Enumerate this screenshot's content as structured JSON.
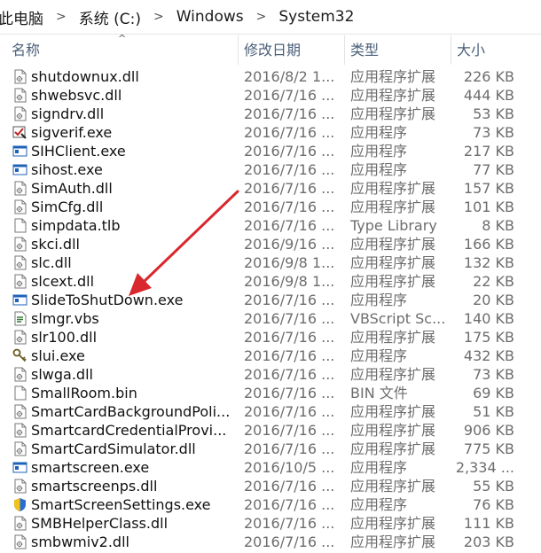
{
  "breadcrumb": {
    "items": [
      "此电脑",
      "系统 (C:)",
      "Windows",
      "System32"
    ],
    "separator": ">"
  },
  "columns": {
    "name": "名称",
    "date": "修改日期",
    "type": "类型",
    "size": "大小"
  },
  "files": [
    {
      "name": "shutdownux.dll",
      "date": "2016/8/2 1...",
      "type": "应用程序扩展",
      "size": "226 KB",
      "icon": "dll-file-icon"
    },
    {
      "name": "shwebsvc.dll",
      "date": "2016/7/16 ...",
      "type": "应用程序扩展",
      "size": "444 KB",
      "icon": "dll-file-icon"
    },
    {
      "name": "signdrv.dll",
      "date": "2016/7/16 ...",
      "type": "应用程序扩展",
      "size": "53 KB",
      "icon": "dll-file-icon"
    },
    {
      "name": "sigverif.exe",
      "date": "2016/7/16 ...",
      "type": "应用程序",
      "size": "73 KB",
      "icon": "sigverif-app-icon"
    },
    {
      "name": "SIHClient.exe",
      "date": "2016/7/16 ...",
      "type": "应用程序",
      "size": "217 KB",
      "icon": "exe-app-icon"
    },
    {
      "name": "sihost.exe",
      "date": "2016/7/16 ...",
      "type": "应用程序",
      "size": "77 KB",
      "icon": "exe-app-icon"
    },
    {
      "name": "SimAuth.dll",
      "date": "2016/7/16 ...",
      "type": "应用程序扩展",
      "size": "157 KB",
      "icon": "dll-file-icon"
    },
    {
      "name": "SimCfg.dll",
      "date": "2016/7/16 ...",
      "type": "应用程序扩展",
      "size": "101 KB",
      "icon": "dll-file-icon"
    },
    {
      "name": "simpdata.tlb",
      "date": "2016/7/16 ...",
      "type": "Type Library",
      "size": "8 KB",
      "icon": "blank-file-icon"
    },
    {
      "name": "skci.dll",
      "date": "2016/9/16 ...",
      "type": "应用程序扩展",
      "size": "166 KB",
      "icon": "dll-file-icon"
    },
    {
      "name": "slc.dll",
      "date": "2016/9/8 1...",
      "type": "应用程序扩展",
      "size": "132 KB",
      "icon": "dll-file-icon"
    },
    {
      "name": "slcext.dll",
      "date": "2016/9/8 1...",
      "type": "应用程序扩展",
      "size": "22 KB",
      "icon": "dll-file-icon"
    },
    {
      "name": "SlideToShutDown.exe",
      "date": "2016/7/16 ...",
      "type": "应用程序",
      "size": "20 KB",
      "icon": "exe-app-icon"
    },
    {
      "name": "slmgr.vbs",
      "date": "2016/7/16 ...",
      "type": "VBScript Sc...",
      "size": "140 KB",
      "icon": "vbscript-file-icon"
    },
    {
      "name": "slr100.dll",
      "date": "2016/7/16 ...",
      "type": "应用程序扩展",
      "size": "175 KB",
      "icon": "dll-file-icon"
    },
    {
      "name": "slui.exe",
      "date": "2016/7/16 ...",
      "type": "应用程序",
      "size": "432 KB",
      "icon": "key-app-icon"
    },
    {
      "name": "slwga.dll",
      "date": "2016/7/16 ...",
      "type": "应用程序扩展",
      "size": "73 KB",
      "icon": "dll-file-icon"
    },
    {
      "name": "SmallRoom.bin",
      "date": "2016/7/16 ...",
      "type": "BIN 文件",
      "size": "69 KB",
      "icon": "blank-file-icon"
    },
    {
      "name": "SmartCardBackgroundPoli...",
      "date": "2016/7/16 ...",
      "type": "应用程序扩展",
      "size": "51 KB",
      "icon": "dll-file-icon"
    },
    {
      "name": "SmartcardCredentialProvi...",
      "date": "2016/7/16 ...",
      "type": "应用程序扩展",
      "size": "906 KB",
      "icon": "dll-file-icon"
    },
    {
      "name": "SmartCardSimulator.dll",
      "date": "2016/7/16 ...",
      "type": "应用程序扩展",
      "size": "775 KB",
      "icon": "dll-file-icon"
    },
    {
      "name": "smartscreen.exe",
      "date": "2016/10/5 ...",
      "type": "应用程序",
      "size": "2,334 ...",
      "icon": "exe-app-icon"
    },
    {
      "name": "smartscreenps.dll",
      "date": "2016/7/16 ...",
      "type": "应用程序扩展",
      "size": "55 KB",
      "icon": "dll-file-icon"
    },
    {
      "name": "SmartScreenSettings.exe",
      "date": "2016/7/16 ...",
      "type": "应用程序",
      "size": "76 KB",
      "icon": "shield-app-icon"
    },
    {
      "name": "SMBHelperClass.dll",
      "date": "2016/7/16 ...",
      "type": "应用程序扩展",
      "size": "111 KB",
      "icon": "dll-file-icon"
    },
    {
      "name": "smbwmiv2.dll",
      "date": "2016/7/16 ...",
      "type": "应用程序扩展",
      "size": "203 KB",
      "icon": "dll-file-icon"
    }
  ],
  "colors": {
    "header_text": "#4c607a",
    "detail_text": "#6d6d6d",
    "annotation_arrow": "#d9272e",
    "exe_icon_blue": "#1e62b8"
  }
}
